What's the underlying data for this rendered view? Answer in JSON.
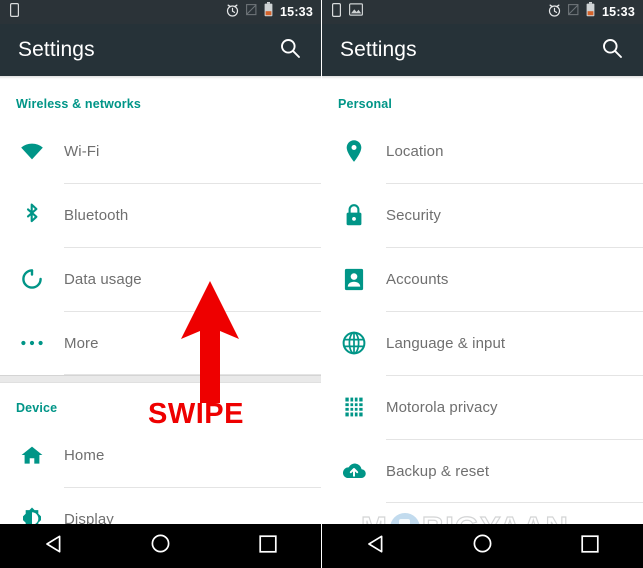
{
  "screens": [
    {
      "id": "left-screen",
      "statusbar": {
        "left_icons": [
          "sim-card-icon"
        ],
        "right_icons": [
          "alarm-icon",
          "no-signal-icon",
          "battery-low-icon"
        ],
        "time": "15:33"
      },
      "appbar": {
        "title": "Settings",
        "search_label": "Search",
        "search_icon": "search-icon"
      },
      "sections": [
        {
          "header": "Wireless & networks",
          "items": [
            {
              "label": "Wi-Fi",
              "icon": "wifi-icon"
            },
            {
              "label": "Bluetooth",
              "icon": "bluetooth-icon"
            },
            {
              "label": "Data usage",
              "icon": "data-usage-icon"
            },
            {
              "label": "More",
              "icon": "more-horizontal-icon"
            }
          ]
        },
        {
          "header": "Device",
          "items": [
            {
              "label": "Home",
              "icon": "home-icon"
            },
            {
              "label": "Display",
              "icon": "brightness-icon"
            }
          ]
        }
      ],
      "annotation": {
        "text": "SWIPE",
        "arrow": "up-arrow-annotation",
        "color": "#ee0000"
      },
      "navbar": {
        "back": "back-triangle-icon",
        "home": "home-circle-icon",
        "recents": "recents-square-icon"
      }
    },
    {
      "id": "right-screen",
      "statusbar": {
        "left_icons": [
          "sim-card-icon",
          "screenshot-icon"
        ],
        "right_icons": [
          "alarm-icon",
          "no-signal-icon",
          "battery-low-icon"
        ],
        "time": "15:33"
      },
      "appbar": {
        "title": "Settings",
        "search_label": "Search",
        "search_icon": "search-icon"
      },
      "sections": [
        {
          "header": "Personal",
          "items": [
            {
              "label": "Location",
              "icon": "location-pin-icon"
            },
            {
              "label": "Security",
              "icon": "lock-icon"
            },
            {
              "label": "Accounts",
              "icon": "account-icon"
            },
            {
              "label": "Language & input",
              "icon": "globe-icon"
            },
            {
              "label": "Motorola privacy",
              "icon": "grid-icon"
            },
            {
              "label": "Backup & reset",
              "icon": "cloud-upload-icon"
            }
          ]
        }
      ],
      "annotation": {
        "arrow": "down-left-arrow-annotation",
        "color": "#ee0000"
      },
      "watermark": {
        "text_before": "M",
        "text_after": "BIGYAAN",
        "logo": "mobigyaan-logo-icon"
      },
      "navbar": {
        "back": "back-triangle-icon",
        "home": "home-circle-icon",
        "recents": "recents-square-icon"
      }
    }
  ],
  "colors": {
    "appbar": "#263238",
    "statusbar": "#2b3338",
    "accent_teal": "#009587",
    "annotation_red": "#ee0000",
    "label_gray": "#6f6f6f",
    "navbar": "#000000",
    "battery_orange": "#d4622a"
  }
}
